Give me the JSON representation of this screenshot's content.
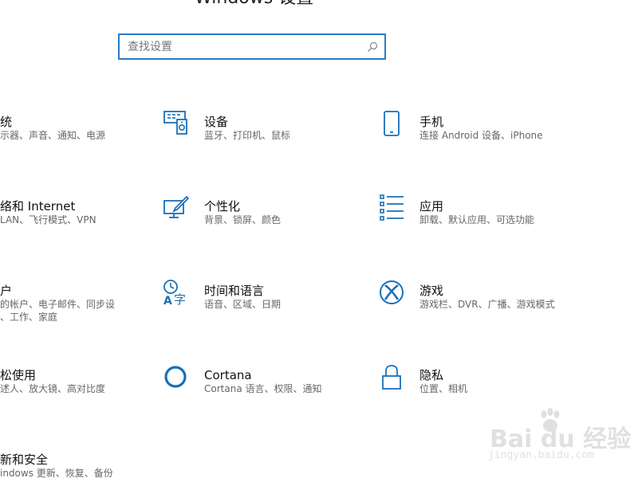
{
  "window": {
    "title": "Windows 设置"
  },
  "search": {
    "placeholder": "查找设置"
  },
  "tiles": [
    {
      "title": "统",
      "desc1": "示器、声音、通知、电源",
      "desc2": "",
      "icon": "system-icon"
    },
    {
      "title": "设备",
      "desc1": "蓝牙、打印机、鼠标",
      "desc2": "",
      "icon": "devices-icon"
    },
    {
      "title": "手机",
      "desc1": "连接 Android 设备、iPhone",
      "desc2": "",
      "icon": "phone-icon"
    },
    {
      "title": "络和 Internet",
      "desc1": "LAN、飞行模式、VPN",
      "desc2": "",
      "icon": "network-icon"
    },
    {
      "title": "个性化",
      "desc1": "背景、锁屏、颜色",
      "desc2": "",
      "icon": "personalization-icon"
    },
    {
      "title": "应用",
      "desc1": "卸载、默认应用、可选功能",
      "desc2": "",
      "icon": "apps-icon"
    },
    {
      "title": "户",
      "desc1": "的帐户、电子邮件、同步设",
      "desc2": "、工作、家庭",
      "icon": "accounts-icon"
    },
    {
      "title": "时间和语言",
      "desc1": "语音、区域、日期",
      "desc2": "",
      "icon": "time-language-icon"
    },
    {
      "title": "游戏",
      "desc1": "游戏栏、DVR、广播、游戏模式",
      "desc2": "",
      "icon": "gaming-icon"
    },
    {
      "title": "松使用",
      "desc1": "述人、放大镜、高对比度",
      "desc2": "",
      "icon": "ease-of-access-icon"
    },
    {
      "title": "Cortana",
      "desc1": "Cortana 语言、权限、通知",
      "desc2": "",
      "icon": "cortana-icon"
    },
    {
      "title": "隐私",
      "desc1": "位置、相机",
      "desc2": "",
      "icon": "privacy-icon"
    },
    {
      "title": "新和安全",
      "desc1": "indows 更新、恢复、备份",
      "desc2": "",
      "icon": "update-security-icon"
    }
  ],
  "watermark": {
    "text": "Bai du 经验",
    "sub": "jingyan.baidu.com"
  },
  "colors": {
    "accent": "#1a6fb8",
    "search_border": "#2a7cc7"
  }
}
